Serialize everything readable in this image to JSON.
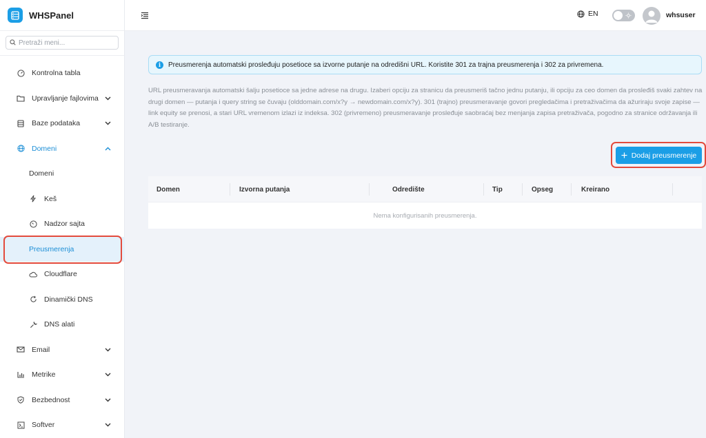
{
  "app": {
    "name": "WHSPanel"
  },
  "sidebar": {
    "search_placeholder": "Pretraži meni...",
    "items": [
      {
        "label": "Kontrolna tabla",
        "icon": "dashboard-icon"
      },
      {
        "label": "Upravljanje fajlovima",
        "icon": "folder-icon"
      },
      {
        "label": "Baze podataka",
        "icon": "database-icon"
      },
      {
        "label": "Domeni",
        "icon": "globe-icon"
      },
      {
        "label": "Domeni"
      },
      {
        "label": "Keš",
        "icon": "lightning-icon"
      },
      {
        "label": "Nadzor sajta",
        "icon": "gauge-icon"
      },
      {
        "label": "Preusmerenja"
      },
      {
        "label": "Cloudflare",
        "icon": "cloud-icon"
      },
      {
        "label": "Dinamički DNS",
        "icon": "refresh-icon"
      },
      {
        "label": "DNS alati",
        "icon": "wrench-icon"
      },
      {
        "label": "Email",
        "icon": "mail-icon"
      },
      {
        "label": "Metrike",
        "icon": "chart-icon"
      },
      {
        "label": "Bezbednost",
        "icon": "shield-icon"
      },
      {
        "label": "Softver",
        "icon": "terminal-icon"
      }
    ]
  },
  "header": {
    "language": "EN",
    "username": "whsuser"
  },
  "main": {
    "alert": "Preusmerenja automatski prosleđuju posetioce sa izvorne putanje na odredišni URL. Koristite 301 za trajna preusmerenja i 302 za privremena.",
    "description": "URL preusmeravanja automatski šalju posetioce sa jedne adrese na drugu. Izaberi opciju za stranicu da preusmeriš tačno jednu putanju, ili opciju za ceo domen da prosleđiš svaki zahtev na drugi domen — putanja i query string se čuvaju (olddomain.com/x?y → newdomain.com/x?y). 301 (trajno) preusmeravanje govori pregledačima i pretraživačima da ažuriraju svoje zapise — link equity se prenosi, a stari URL vremenom izlazi iz indeksa. 302 (privremeno) preusmeravanje prosleđuje saobraćaj bez menjanja zapisa pretraživača, pogodno za stranice održavanja ili A/B testiranje.",
    "add_button": "Dodaj preusmerenje",
    "table": {
      "columns": [
        "Domen",
        "Izvorna putanja",
        "Odredište",
        "Tip",
        "Opseg",
        "Kreirano"
      ],
      "empty": "Nema konfigurisanih preusmerenja."
    }
  },
  "colors": {
    "accent": "#1b9ee6",
    "highlight": "#e34a3c",
    "selected_bg": "#e4f1fb"
  }
}
